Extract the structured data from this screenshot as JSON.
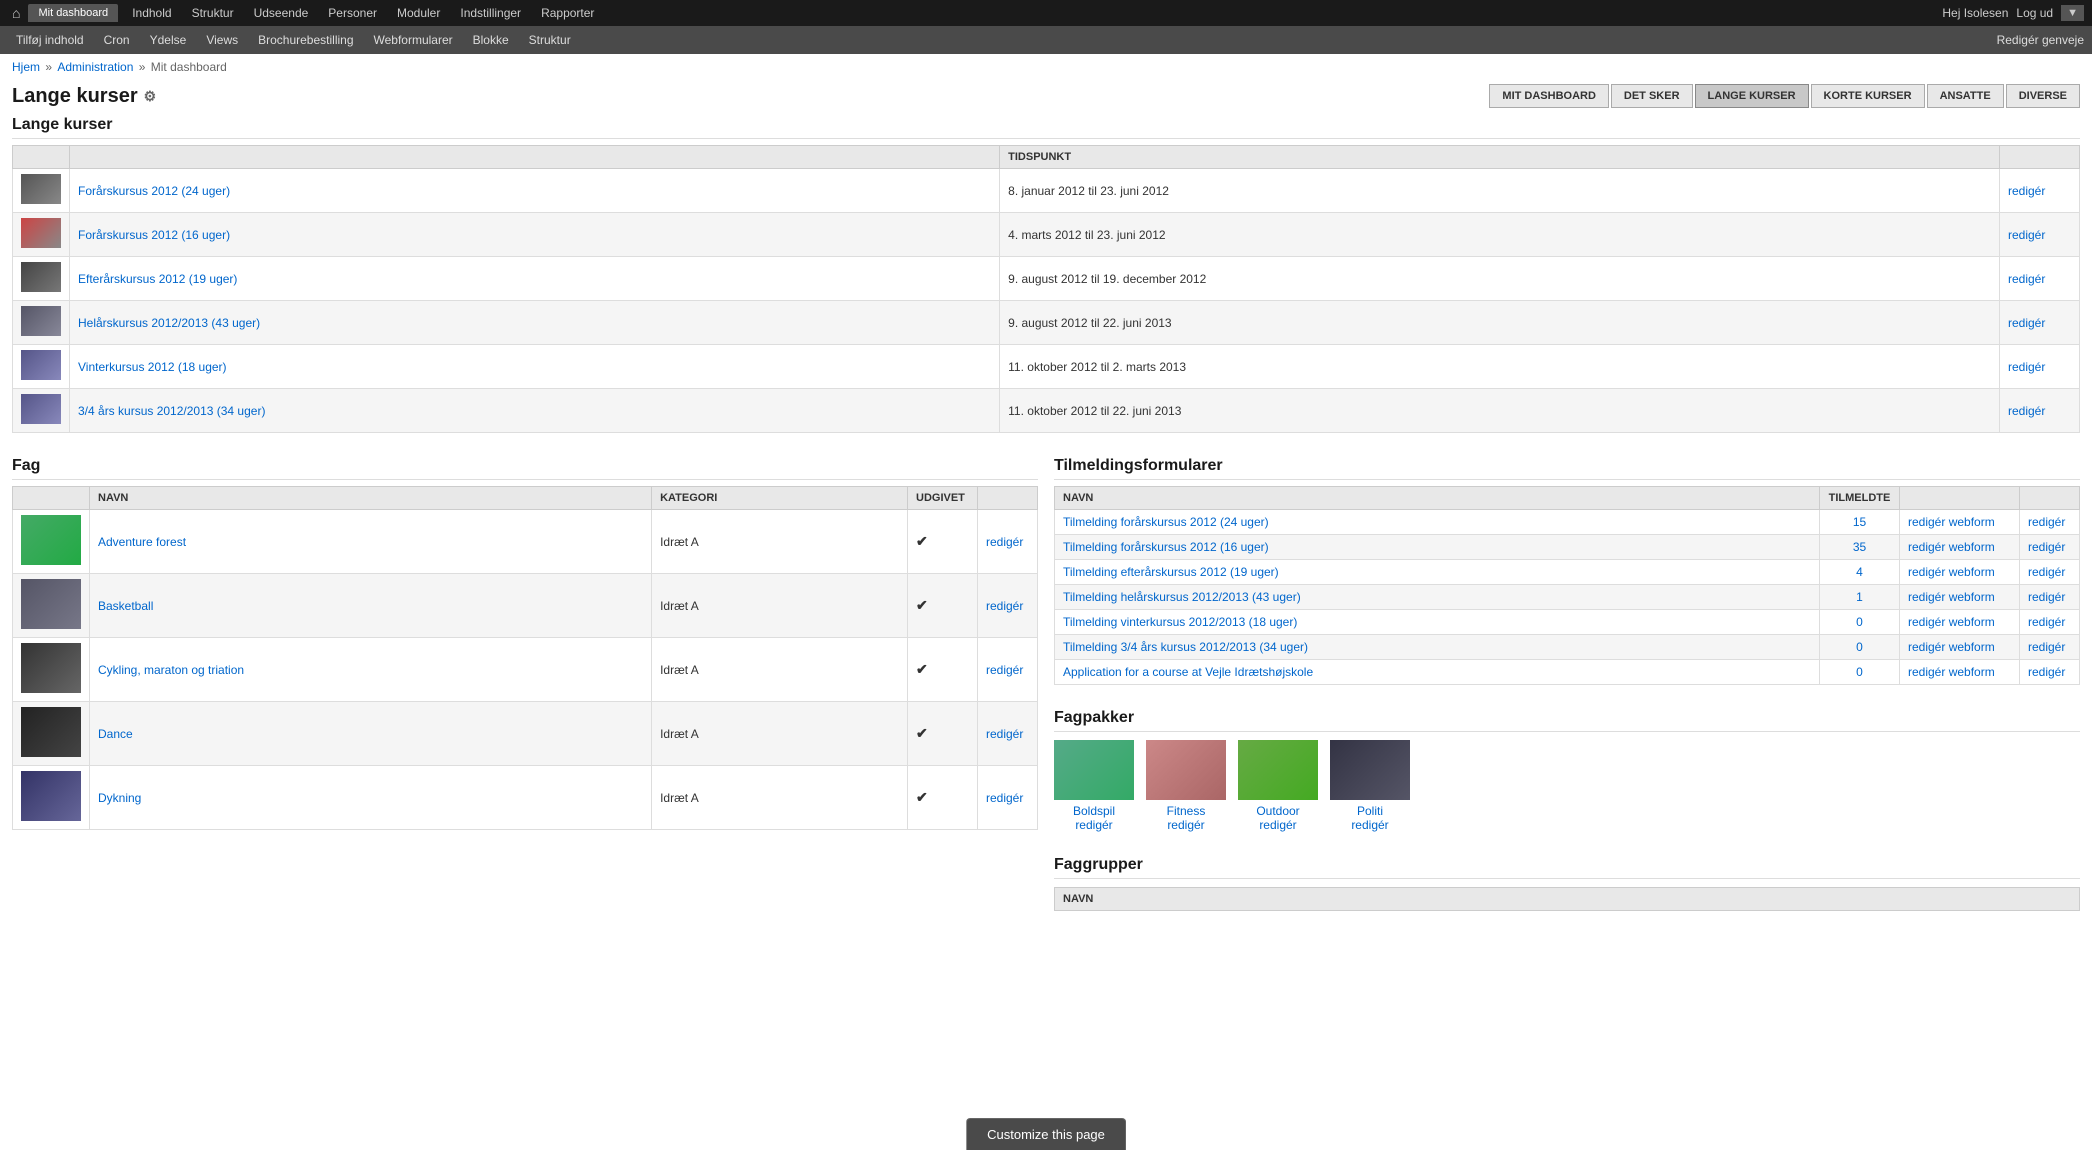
{
  "topnav": {
    "home_icon": "⌂",
    "active_tab": "Mit dashboard",
    "menu_items": [
      "Indhold",
      "Struktur",
      "Udseende",
      "Personer",
      "Moduler",
      "Indstillinger",
      "Rapporter"
    ],
    "user_greeting": "Hej Isolesen",
    "logout": "Log ud",
    "arrow": "▼"
  },
  "secondary_nav": {
    "items": [
      "Tilføj indhold",
      "Cron",
      "Ydelse",
      "Views",
      "Brochurebestilling",
      "Webformularer",
      "Blokke",
      "Struktur"
    ],
    "right_link": "Redigér genveje"
  },
  "breadcrumb": {
    "home": "Hjem",
    "admin": "Administration",
    "current": "Mit dashboard"
  },
  "page": {
    "title": "Lange kurser",
    "settings_icon": "⚙"
  },
  "tabs": [
    {
      "label": "MIT DASHBOARD",
      "active": false
    },
    {
      "label": "DET SKER",
      "active": false
    },
    {
      "label": "LANGE KURSER",
      "active": true
    },
    {
      "label": "KORTE KURSER",
      "active": false
    },
    {
      "label": "ANSATTE",
      "active": false
    },
    {
      "label": "DIVERSE",
      "active": false
    }
  ],
  "lange_kurser": {
    "title": "Lange kurser",
    "columns": [
      "",
      "",
      "TIDSPUNKT",
      ""
    ],
    "rows": [
      {
        "img": "img1",
        "name": "Forårskursus 2012 (24 uger)",
        "date": "8. januar 2012 til 23. juni 2012",
        "edit": "redigér"
      },
      {
        "img": "img2",
        "name": "Forårskursus 2012 (16 uger)",
        "date": "4. marts 2012 til 23. juni 2012",
        "edit": "redigér"
      },
      {
        "img": "img3",
        "name": "Efterårskursus 2012 (19 uger)",
        "date": "9. august 2012 til 19. december 2012",
        "edit": "redigér"
      },
      {
        "img": "img4",
        "name": "Helårskursus 2012/2013 (43 uger)",
        "date": "9. august 2012 til 22. juni 2013",
        "edit": "redigér"
      },
      {
        "img": "img5",
        "name": "Vinterkursus 2012 (18 uger)",
        "date": "11. oktober 2012 til 2. marts 2013",
        "edit": "redigér"
      },
      {
        "img": "img6",
        "name": "3/4 års kursus 2012/2013 (34 uger)",
        "date": "11. oktober 2012 til 22. juni 2013",
        "edit": "redigér"
      }
    ]
  },
  "fag": {
    "title": "Fag",
    "columns": [
      "NAVN",
      "KATEGORI",
      "UDGIVET",
      ""
    ],
    "rows": [
      {
        "img": "f1",
        "name": "Adventure forest",
        "kategori": "Idræt A",
        "udgivet": "✔",
        "edit": "redigér"
      },
      {
        "img": "f2",
        "name": "Basketball",
        "kategori": "Idræt A",
        "udgivet": "✔",
        "edit": "redigér"
      },
      {
        "img": "f3",
        "name": "Cykling, maraton og triation",
        "kategori": "Idræt A",
        "udgivet": "✔",
        "edit": "redigér"
      },
      {
        "img": "f4",
        "name": "Dance",
        "kategori": "Idræt A",
        "udgivet": "✔",
        "edit": "redigér"
      },
      {
        "img": "f5",
        "name": "Dykning",
        "kategori": "Idræt A",
        "udgivet": "✔",
        "edit": "redigér"
      }
    ]
  },
  "tilmeldingsformularer": {
    "title": "Tilmeldingsformularer",
    "columns": [
      "NAVN",
      "TILMELDTE",
      "",
      ""
    ],
    "rows": [
      {
        "name": "Tilmelding forårskursus 2012 (24 uger)",
        "count": "15",
        "edit_webform": "redigér webform",
        "edit": "redigér"
      },
      {
        "name": "Tilmelding forårskursus 2012 (16 uger)",
        "count": "35",
        "edit_webform": "redigér webform",
        "edit": "redigér"
      },
      {
        "name": "Tilmelding efterårskursus 2012 (19 uger)",
        "count": "4",
        "edit_webform": "redigér webform",
        "edit": "redigér"
      },
      {
        "name": "Tilmelding helårskursus 2012/2013 (43 uger)",
        "count": "1",
        "edit_webform": "redigér webform",
        "edit": "redigér"
      },
      {
        "name": "Tilmelding vinterkursus 2012/2013 (18 uger)",
        "count": "0",
        "edit_webform": "redigér webform",
        "edit": "redigér"
      },
      {
        "name": "Tilmelding 3/4 års kursus 2012/2013 (34 uger)",
        "count": "0",
        "edit_webform": "redigér webform",
        "edit": "redigér"
      },
      {
        "name": "Application for a course at Vejle Idrætshøjskole",
        "count": "0",
        "edit_webform": "redigér webform",
        "edit": "redigér"
      }
    ]
  },
  "fagpakker": {
    "title": "Fagpakker",
    "items": [
      {
        "img": "fp1",
        "name": "Boldspil",
        "edit": "redigér"
      },
      {
        "img": "fp2",
        "name": "Fitness",
        "edit": "redigér"
      },
      {
        "img": "fp3",
        "name": "Outdoor",
        "edit": "redigér"
      },
      {
        "img": "fp4",
        "name": "Politi",
        "edit": "redigér"
      }
    ]
  },
  "faggrupper": {
    "title": "Faggrupper",
    "columns": [
      "NAVN"
    ]
  },
  "customize": {
    "label": "Customize this page"
  }
}
